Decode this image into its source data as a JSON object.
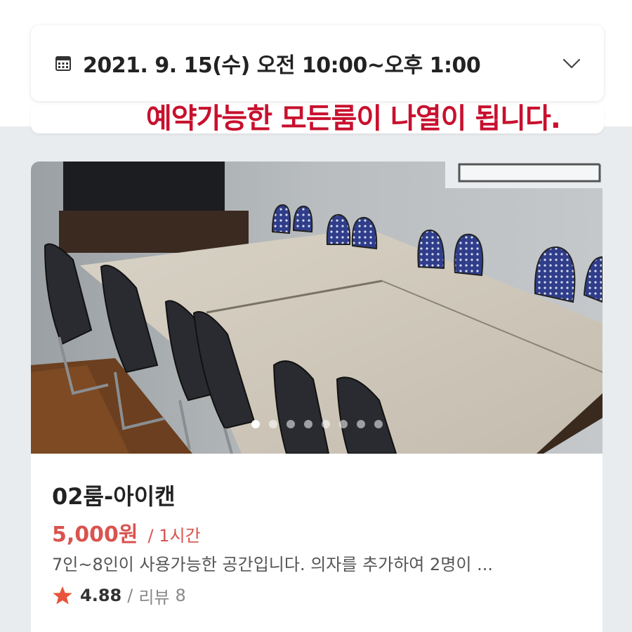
{
  "date_selector": {
    "icon": "calendar-icon",
    "date_range": "2021. 9. 15(수) 오전 10:00~오후 1:00",
    "expand_icon": "chevron-down-icon"
  },
  "overlay_caption": "예약가능한 모든룸이 나열이 됩니다.",
  "room": {
    "name": "02룸-아이캔",
    "price": "5,000원",
    "unit": "/ 1시간",
    "description": "7인~8인이 사용가능한 공간입니다. 의자를 추가하여 2명이 ...",
    "rating": "4.88",
    "separator": "/",
    "review_label": "리뷰",
    "review_count": "8",
    "photo_count": 8,
    "active_photo": 1
  },
  "colors": {
    "accent": "#d9534f",
    "caption": "#c8102e",
    "star": "#e8533a",
    "background": "#e9ecef"
  }
}
